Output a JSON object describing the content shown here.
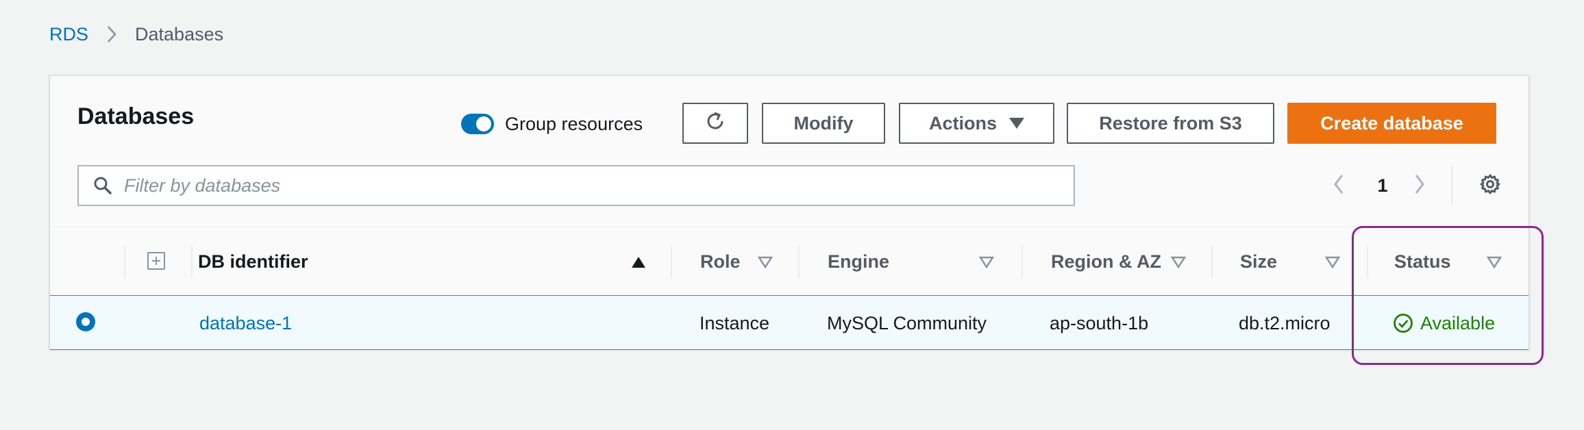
{
  "breadcrumb": {
    "root": "RDS",
    "current": "Databases"
  },
  "panel": {
    "title": "Databases",
    "group_toggle_label": "Group resources",
    "group_toggle_on": true
  },
  "toolbar": {
    "refresh_icon": "refresh-icon",
    "modify_label": "Modify",
    "actions_label": "Actions",
    "restore_label": "Restore from S3",
    "create_label": "Create database"
  },
  "filter": {
    "placeholder": "Filter by databases",
    "value": ""
  },
  "pagination": {
    "current_page": "1"
  },
  "colors": {
    "primary": "#ec7211",
    "link": "#0073bb",
    "available": "#1d8102",
    "highlight": "#8b2a8e"
  },
  "table": {
    "columns": [
      "DB identifier",
      "Role",
      "Engine",
      "Region & AZ",
      "Size",
      "Status"
    ],
    "rows": [
      {
        "selected": true,
        "db_identifier": "database-1",
        "role": "Instance",
        "engine": "MySQL Community",
        "region_az": "ap-south-1b",
        "size": "db.t2.micro",
        "status": "Available"
      }
    ]
  }
}
